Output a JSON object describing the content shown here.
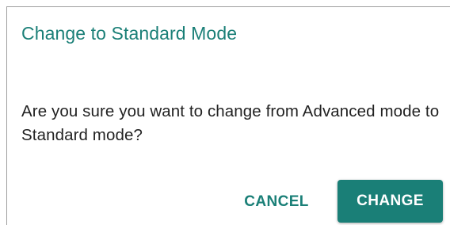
{
  "dialog": {
    "title": "Change to Standard Mode",
    "message": "Are you sure you want to change from Advanced mode to Standard mode?",
    "actions": {
      "cancel_label": "CANCEL",
      "change_label": "CHANGE"
    }
  },
  "colors": {
    "accent": "#1a7f77",
    "text": "#222222",
    "button_text": "#ffffff"
  }
}
